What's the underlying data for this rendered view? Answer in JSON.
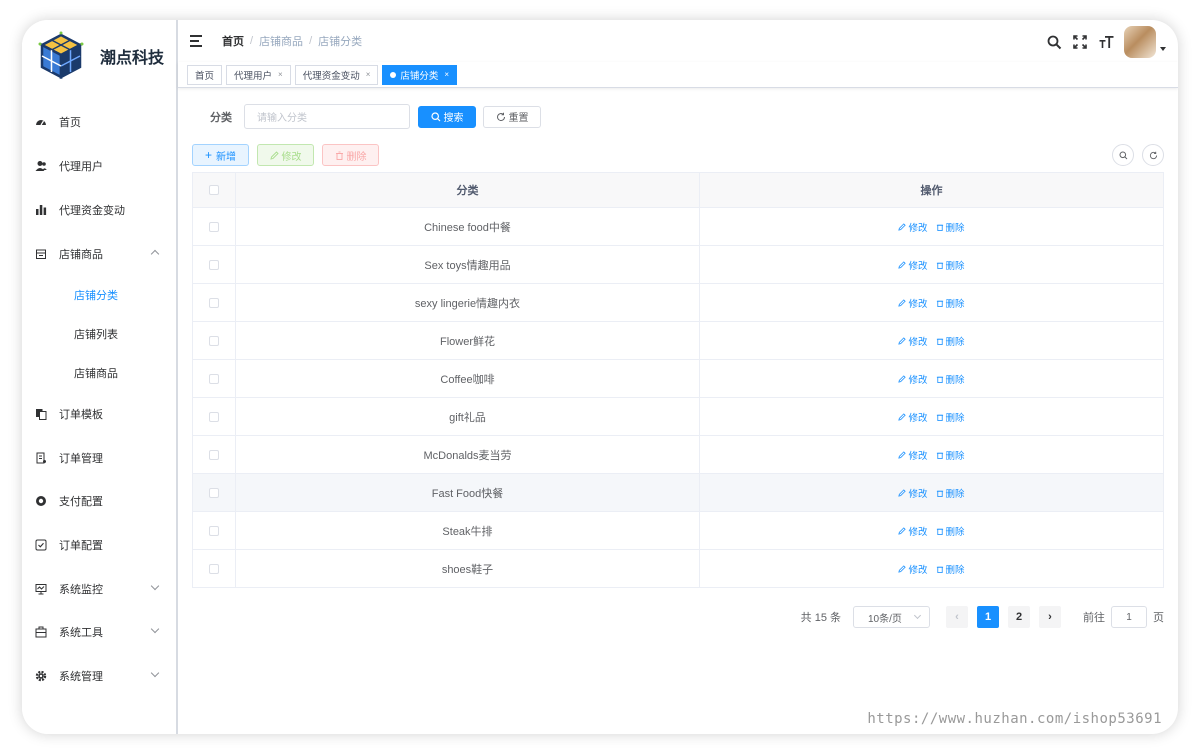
{
  "brand": {
    "name": "潮点科技"
  },
  "sidebar": {
    "items": [
      {
        "label": "首页",
        "icon": "dashboard-icon"
      },
      {
        "label": "代理用户",
        "icon": "users-icon"
      },
      {
        "label": "代理资金变动",
        "icon": "bar-chart-icon"
      },
      {
        "label": "店铺商品",
        "icon": "shop-icon",
        "expanded": true
      },
      {
        "label": "订单模板",
        "icon": "copy-icon"
      },
      {
        "label": "订单管理",
        "icon": "list-icon"
      },
      {
        "label": "支付配置",
        "icon": "settings-circle-icon"
      },
      {
        "label": "订单配置",
        "icon": "check-square-icon"
      },
      {
        "label": "系统监控",
        "icon": "monitor-icon"
      },
      {
        "label": "系统工具",
        "icon": "toolbox-icon"
      },
      {
        "label": "系统管理",
        "icon": "gear-icon"
      }
    ],
    "sub_items": [
      {
        "label": "店铺分类",
        "active": true
      },
      {
        "label": "店铺列表"
      },
      {
        "label": "店铺商品"
      }
    ]
  },
  "breadcrumb": [
    "首页",
    "店铺商品",
    "店铺分类"
  ],
  "tags": [
    {
      "label": "首页",
      "closable": false
    },
    {
      "label": "代理用户",
      "closable": true
    },
    {
      "label": "代理资金变动",
      "closable": true
    },
    {
      "label": "店铺分类",
      "closable": true,
      "active": true
    }
  ],
  "tag_close": "×",
  "search": {
    "label": "分类",
    "placeholder": "请输入分类",
    "search_btn": "搜索",
    "reset_btn": "重置"
  },
  "toolbar": {
    "add": "新增",
    "edit": "修改",
    "delete": "删除"
  },
  "table": {
    "headers": [
      "分类",
      "操作"
    ],
    "rows": [
      "Chinese food中餐",
      "Sex toys情趣用品",
      "sexy lingerie情趣内衣",
      "Flower鲜花",
      "Coffee咖啡",
      "gift礼品",
      "McDonalds麦当劳",
      "Fast Food快餐",
      "Steak牛排",
      "shoes鞋子"
    ],
    "row_actions": {
      "edit": "修改",
      "delete": "删除"
    }
  },
  "pagination": {
    "total_text": "共 15 条",
    "page_size": "10条/页",
    "pages": [
      "1",
      "2"
    ],
    "current_page": "1",
    "goto_label": "前往",
    "goto_value": "1",
    "page_suffix": "页"
  },
  "watermark": "https://www.huzhan.com/ishop53691",
  "colors": {
    "primary": "#1890ff",
    "sidebar_active": "#1890ff"
  }
}
